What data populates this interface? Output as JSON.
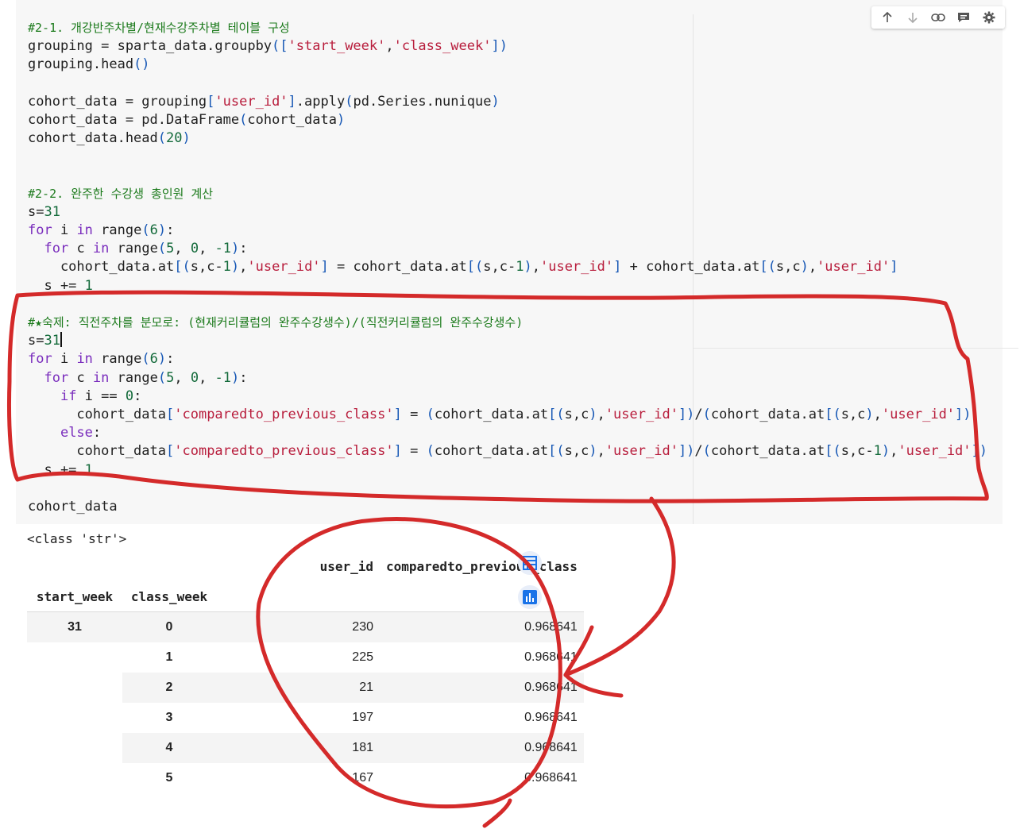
{
  "code_lines": [
    [
      {
        "t": "#2-1. 개강반주차별/현재수강주차별 테이블 구성",
        "c": "cm"
      }
    ],
    [
      {
        "t": "grouping = sparta_data.groupby"
      },
      {
        "t": "(",
        "c": "br"
      },
      {
        "t": "[",
        "c": "br"
      },
      {
        "t": "'start_week'",
        "c": "st"
      },
      {
        "t": ","
      },
      {
        "t": "'class_week'",
        "c": "st"
      },
      {
        "t": "])",
        "c": "br"
      }
    ],
    [
      {
        "t": "grouping.head"
      },
      {
        "t": "()",
        "c": "br"
      }
    ],
    [],
    [
      {
        "t": "cohort_data = grouping"
      },
      {
        "t": "[",
        "c": "br"
      },
      {
        "t": "'user_id'",
        "c": "st"
      },
      {
        "t": "]",
        "c": "br"
      },
      {
        "t": ".apply"
      },
      {
        "t": "(",
        "c": "br"
      },
      {
        "t": "pd.Series.nunique"
      },
      {
        "t": ")",
        "c": "br"
      }
    ],
    [
      {
        "t": "cohort_data = pd.DataFrame"
      },
      {
        "t": "(",
        "c": "br"
      },
      {
        "t": "cohort_data"
      },
      {
        "t": ")",
        "c": "br"
      }
    ],
    [
      {
        "t": "cohort_data.head"
      },
      {
        "t": "(",
        "c": "br"
      },
      {
        "t": "20",
        "c": "nm"
      },
      {
        "t": ")",
        "c": "br"
      }
    ],
    [],
    [],
    [
      {
        "t": "#2-2. 완주한 수강생 총인원 계산",
        "c": "cm"
      }
    ],
    [
      {
        "t": "s="
      },
      {
        "t": "31",
        "c": "nm"
      }
    ],
    [
      {
        "t": "for",
        "c": "kw"
      },
      {
        "t": " i "
      },
      {
        "t": "in",
        "c": "kw"
      },
      {
        "t": " range"
      },
      {
        "t": "(",
        "c": "br"
      },
      {
        "t": "6",
        "c": "nm"
      },
      {
        "t": ")",
        "c": "br"
      },
      {
        "t": ":"
      }
    ],
    [
      {
        "t": "  "
      },
      {
        "t": "for",
        "c": "kw"
      },
      {
        "t": " c "
      },
      {
        "t": "in",
        "c": "kw"
      },
      {
        "t": " range"
      },
      {
        "t": "(",
        "c": "br"
      },
      {
        "t": "5",
        "c": "nm"
      },
      {
        "t": ", "
      },
      {
        "t": "0",
        "c": "nm"
      },
      {
        "t": ", "
      },
      {
        "t": "-1",
        "c": "nm"
      },
      {
        "t": ")",
        "c": "br"
      },
      {
        "t": ":"
      }
    ],
    [
      {
        "t": "    cohort_data.at"
      },
      {
        "t": "[(",
        "c": "br"
      },
      {
        "t": "s,c-"
      },
      {
        "t": "1",
        "c": "nm"
      },
      {
        "t": ")",
        "c": "br"
      },
      {
        "t": ","
      },
      {
        "t": "'user_id'",
        "c": "st"
      },
      {
        "t": "]",
        "c": "br"
      },
      {
        "t": " = cohort_data.at"
      },
      {
        "t": "[(",
        "c": "br"
      },
      {
        "t": "s,c-"
      },
      {
        "t": "1",
        "c": "nm"
      },
      {
        "t": ")",
        "c": "br"
      },
      {
        "t": ","
      },
      {
        "t": "'user_id'",
        "c": "st"
      },
      {
        "t": "]",
        "c": "br"
      },
      {
        "t": " + cohort_data.at"
      },
      {
        "t": "[(",
        "c": "br"
      },
      {
        "t": "s,c"
      },
      {
        "t": ")",
        "c": "br"
      },
      {
        "t": ","
      },
      {
        "t": "'user_id'",
        "c": "st"
      },
      {
        "t": "]",
        "c": "br"
      }
    ],
    [
      {
        "t": "  s += "
      },
      {
        "t": "1",
        "c": "nm"
      }
    ],
    [],
    [
      {
        "t": "#★숙제: 직전주차를 분모로: (현재커리큘럼의 완주수강생수)/(직전커리큘럼의 완주수강생수)",
        "c": "cm"
      }
    ],
    [
      {
        "t": "s="
      },
      {
        "t": "31",
        "c": "nm"
      },
      {
        "t": "CURSOR"
      }
    ],
    [
      {
        "t": "for",
        "c": "kw"
      },
      {
        "t": " i "
      },
      {
        "t": "in",
        "c": "kw"
      },
      {
        "t": " range"
      },
      {
        "t": "(",
        "c": "br"
      },
      {
        "t": "6",
        "c": "nm"
      },
      {
        "t": ")",
        "c": "br"
      },
      {
        "t": ":"
      }
    ],
    [
      {
        "t": "  "
      },
      {
        "t": "for",
        "c": "kw"
      },
      {
        "t": " c "
      },
      {
        "t": "in",
        "c": "kw"
      },
      {
        "t": " range"
      },
      {
        "t": "(",
        "c": "br"
      },
      {
        "t": "5",
        "c": "nm"
      },
      {
        "t": ", "
      },
      {
        "t": "0",
        "c": "nm"
      },
      {
        "t": ", "
      },
      {
        "t": "-1",
        "c": "nm"
      },
      {
        "t": ")",
        "c": "br"
      },
      {
        "t": ":"
      }
    ],
    [
      {
        "t": "    "
      },
      {
        "t": "if",
        "c": "kw"
      },
      {
        "t": " i == "
      },
      {
        "t": "0",
        "c": "nm"
      },
      {
        "t": ":"
      }
    ],
    [
      {
        "t": "      cohort_data"
      },
      {
        "t": "[",
        "c": "br"
      },
      {
        "t": "'comparedto_previous_class'",
        "c": "st"
      },
      {
        "t": "]",
        "c": "br"
      },
      {
        "t": " = "
      },
      {
        "t": "(",
        "c": "br"
      },
      {
        "t": "cohort_data.at"
      },
      {
        "t": "[(",
        "c": "br"
      },
      {
        "t": "s,c"
      },
      {
        "t": ")",
        "c": "br"
      },
      {
        "t": ","
      },
      {
        "t": "'user_id'",
        "c": "st"
      },
      {
        "t": "])",
        "c": "br"
      },
      {
        "t": "/"
      },
      {
        "t": "(",
        "c": "br"
      },
      {
        "t": "cohort_data.at"
      },
      {
        "t": "[(",
        "c": "br"
      },
      {
        "t": "s,c"
      },
      {
        "t": ")",
        "c": "br"
      },
      {
        "t": ","
      },
      {
        "t": "'user_id'",
        "c": "st"
      },
      {
        "t": "])",
        "c": "br"
      }
    ],
    [
      {
        "t": "    "
      },
      {
        "t": "else",
        "c": "kw"
      },
      {
        "t": ":"
      }
    ],
    [
      {
        "t": "      cohort_data"
      },
      {
        "t": "[",
        "c": "br"
      },
      {
        "t": "'comparedto_previous_class'",
        "c": "st"
      },
      {
        "t": "]",
        "c": "br"
      },
      {
        "t": " = "
      },
      {
        "t": "(",
        "c": "br"
      },
      {
        "t": "cohort_data.at"
      },
      {
        "t": "[(",
        "c": "br"
      },
      {
        "t": "s,c"
      },
      {
        "t": ")",
        "c": "br"
      },
      {
        "t": ","
      },
      {
        "t": "'user_id'",
        "c": "st"
      },
      {
        "t": "])",
        "c": "br"
      },
      {
        "t": "/"
      },
      {
        "t": "(",
        "c": "br"
      },
      {
        "t": "cohort_data.at"
      },
      {
        "t": "[(",
        "c": "br"
      },
      {
        "t": "s,c-"
      },
      {
        "t": "1",
        "c": "nm"
      },
      {
        "t": ")",
        "c": "br"
      },
      {
        "t": ","
      },
      {
        "t": "'user_id'",
        "c": "st"
      },
      {
        "t": "])",
        "c": "br"
      }
    ],
    [
      {
        "t": "  s += "
      },
      {
        "t": "1",
        "c": "nm"
      }
    ],
    [],
    [
      {
        "t": "cohort_data"
      }
    ]
  ],
  "toolbar": {
    "items": [
      {
        "name": "move-up-icon",
        "glyph": "↑"
      },
      {
        "name": "move-down-icon",
        "glyph": "↓"
      },
      {
        "name": "link-icon",
        "glyph": "link"
      },
      {
        "name": "comment-icon",
        "glyph": "comment"
      },
      {
        "name": "settings-icon",
        "glyph": "⚙"
      }
    ]
  },
  "output": {
    "stdout": "<class 'str'>",
    "columns": [
      "user_id",
      "comparedto_previous_class"
    ],
    "index_names": [
      "start_week",
      "class_week"
    ],
    "rows": [
      {
        "start_week": "31",
        "class_week": "0",
        "user_id": "230",
        "ratio": "0.968641"
      },
      {
        "start_week": "",
        "class_week": "1",
        "user_id": "225",
        "ratio": "0.968641"
      },
      {
        "start_week": "",
        "class_week": "2",
        "user_id": "21",
        "ratio": "0.968641"
      },
      {
        "start_week": "",
        "class_week": "3",
        "user_id": "197",
        "ratio": "0.968641"
      },
      {
        "start_week": "",
        "class_week": "4",
        "user_id": "181",
        "ratio": "0.968641"
      },
      {
        "start_week": "",
        "class_week": "5",
        "user_id": "167",
        "ratio": "0.968641"
      }
    ],
    "side_buttons": [
      "table-convert-icon",
      "chart-suggest-icon"
    ]
  },
  "colors": {
    "annotation": "#d42a2a",
    "accent": "#1a73e8"
  }
}
